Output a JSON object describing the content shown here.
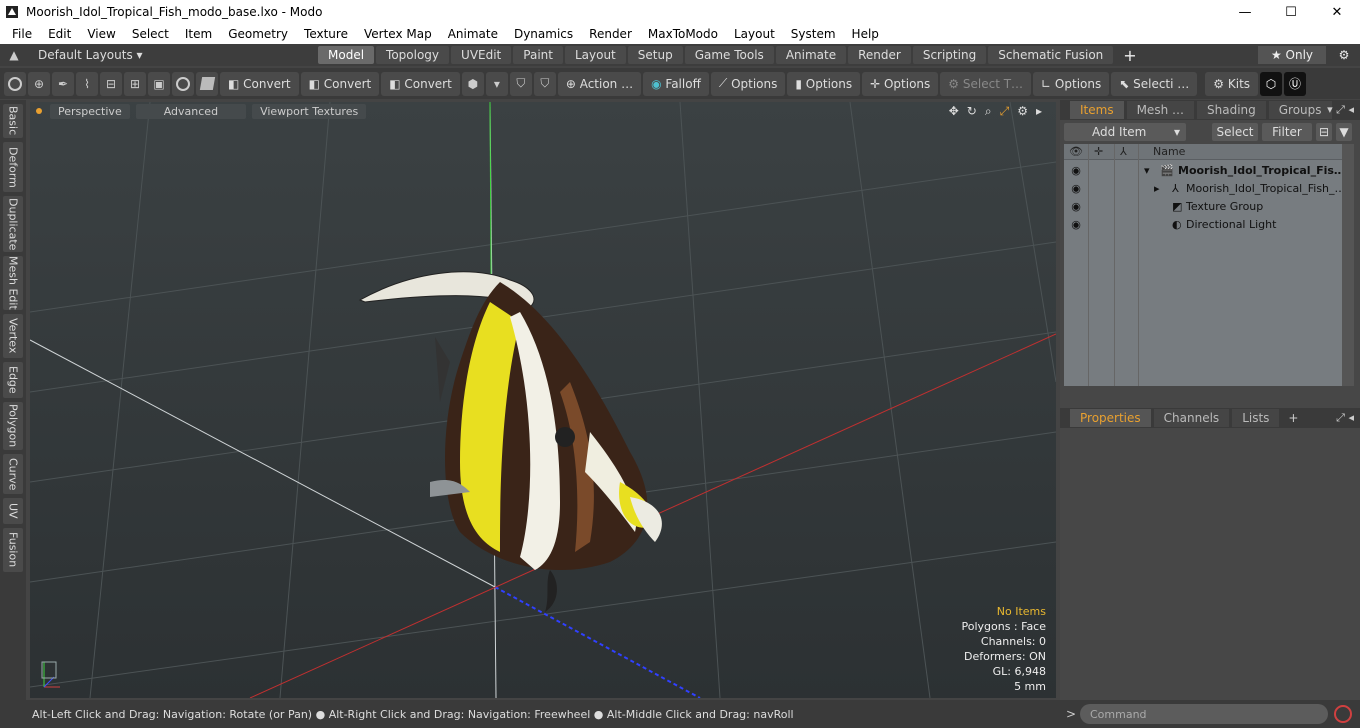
{
  "window": {
    "title": "Moorish_Idol_Tropical_Fish_modo_base.lxo - Modo",
    "controls": {
      "minimize": "—",
      "maximize": "☐",
      "close": "✕"
    }
  },
  "menu": [
    "File",
    "Edit",
    "View",
    "Select",
    "Item",
    "Geometry",
    "Texture",
    "Vertex Map",
    "Animate",
    "Dynamics",
    "Render",
    "MaxToModo",
    "Layout",
    "System",
    "Help"
  ],
  "layoutbar": {
    "layouts_label": "Default Layouts ▾",
    "tabs": [
      "Model",
      "Topology",
      "UVEdit",
      "Paint",
      "Layout",
      "Setup",
      "Game Tools",
      "Animate",
      "Render",
      "Scripting",
      "Schematic Fusion"
    ],
    "active_tab": "Model",
    "plus": "+",
    "only_label": "★  Only"
  },
  "toolbar": {
    "convert_1": "Convert",
    "convert_2": "Convert",
    "convert_3": "Convert",
    "action": "Action  …",
    "falloff": "Falloff",
    "options_1": "Options",
    "options_2": "Options",
    "options_3": "Options",
    "select_t": "Select T…",
    "options_4": "Options",
    "selecti": "Selecti …",
    "kits": "Kits"
  },
  "left_tabs": [
    "Basic",
    "Deform",
    "Duplicate",
    "Mesh Edit",
    "Vertex",
    "Edge",
    "Polygon",
    "Curve",
    "UV",
    "Fusion"
  ],
  "viewport": {
    "tabs": [
      "Perspective",
      "Advanced",
      "Viewport Textures"
    ],
    "stats": {
      "no_items": "No Items",
      "polygons": "Polygons : Face",
      "channels": "Channels: 0",
      "deformers": "Deformers: ON",
      "gl": "GL: 6,948",
      "unit": "5 mm"
    }
  },
  "items_panel": {
    "tabs": [
      "Items",
      "Mesh …",
      "Shading",
      "Groups"
    ],
    "active_tab": "Items",
    "add_item": "Add Item",
    "select": "Select",
    "filter": "Filter",
    "col_name": "Name",
    "rows": [
      {
        "label": "Moorish_Idol_Tropical_Fis…",
        "bold": true
      },
      {
        "label": "Moorish_Idol_Tropical_Fish_…",
        "bold": false
      },
      {
        "label": "Texture Group",
        "bold": false
      },
      {
        "label": "Directional Light",
        "bold": false
      }
    ]
  },
  "properties_panel": {
    "tabs": [
      "Properties",
      "Channels",
      "Lists"
    ],
    "active_tab": "Properties",
    "plus": "+"
  },
  "statusbar": {
    "text": "Alt-Left Click and Drag: Navigation: Rotate (or Pan) ● Alt-Right Click and Drag: Navigation: Freewheel ● Alt-Middle Click and Drag: navRoll"
  },
  "command": {
    "placeholder": "Command"
  }
}
